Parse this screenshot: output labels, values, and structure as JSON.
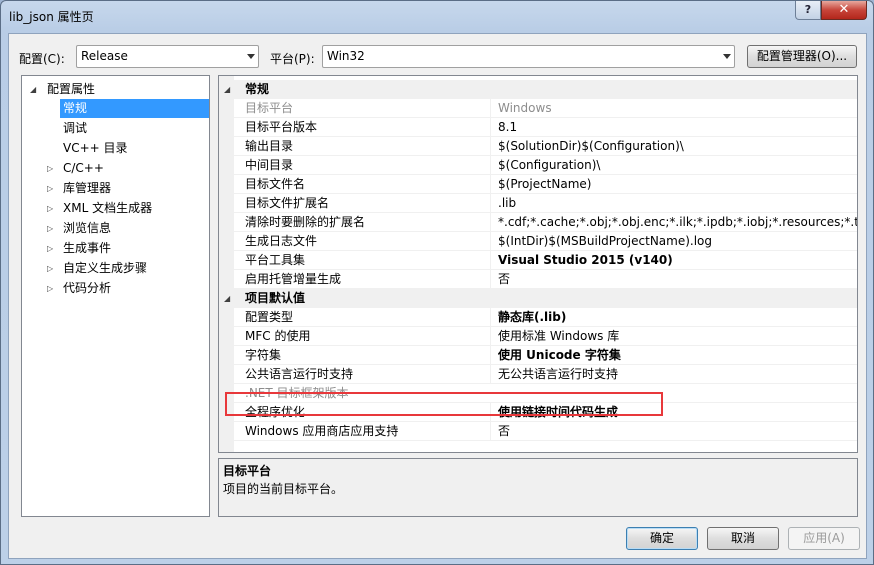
{
  "window": {
    "title": "lib_json 属性页",
    "help_glyph": "?",
    "close_glyph": "✕"
  },
  "config": {
    "label": "配置(C):",
    "value": "Release"
  },
  "platform": {
    "label": "平台(P):",
    "value": "Win32"
  },
  "config_manager_label": "配置管理器(O)...",
  "tree": {
    "items": [
      {
        "label": "配置属性",
        "expander": "◢"
      },
      {
        "label": "常规"
      },
      {
        "label": "调试"
      },
      {
        "label": "VC++ 目录"
      },
      {
        "label": "C/C++",
        "expander": "▷"
      },
      {
        "label": "库管理器",
        "expander": "▷"
      },
      {
        "label": "XML 文档生成器",
        "expander": "▷"
      },
      {
        "label": "浏览信息",
        "expander": "▷"
      },
      {
        "label": "生成事件",
        "expander": "▷"
      },
      {
        "label": "自定义生成步骤",
        "expander": "▷"
      },
      {
        "label": "代码分析",
        "expander": "▷"
      }
    ]
  },
  "grid": {
    "sections": [
      {
        "title": "常规",
        "expander": "◢"
      },
      {
        "title": "项目默认值",
        "expander": "◢"
      }
    ],
    "rows": [
      {
        "name": "目标平台",
        "value": "Windows"
      },
      {
        "name": "目标平台版本",
        "value": "8.1"
      },
      {
        "name": "输出目录",
        "value": "$(SolutionDir)$(Configuration)\\"
      },
      {
        "name": "中间目录",
        "value": "$(Configuration)\\"
      },
      {
        "name": "目标文件名",
        "value": "$(ProjectName)"
      },
      {
        "name": "目标文件扩展名",
        "value": ".lib"
      },
      {
        "name": "清除时要删除的扩展名",
        "value": "*.cdf;*.cache;*.obj;*.obj.enc;*.ilk;*.ipdb;*.iobj;*.resources;*.tlb;*.tli;*.tlh;*.tmp"
      },
      {
        "name": "生成日志文件",
        "value": "$(IntDir)$(MSBuildProjectName).log"
      },
      {
        "name": "平台工具集",
        "value": "Visual Studio 2015 (v140)"
      },
      {
        "name": "启用托管增量生成",
        "value": "否"
      },
      {
        "name": "配置类型",
        "value": "静态库(.lib)"
      },
      {
        "name": "MFC 的使用",
        "value": "使用标准 Windows 库"
      },
      {
        "name": "字符集",
        "value": "使用 Unicode 字符集"
      },
      {
        "name": "公共语言运行时支持",
        "value": "无公共语言运行时支持"
      },
      {
        "name": ".NET 目标框架版本",
        "value": ""
      },
      {
        "name": "全程序优化",
        "value": "使用链接时间代码生成"
      },
      {
        "name": "Windows 应用商店应用支持",
        "value": "否"
      }
    ]
  },
  "description": {
    "title": "目标平台",
    "text": "项目的当前目标平台。"
  },
  "buttons": {
    "ok": "确定",
    "cancel": "取消",
    "apply": "应用(A)"
  },
  "colors": {
    "selection": "#3399ff",
    "highlight_border": "#e8383b"
  }
}
